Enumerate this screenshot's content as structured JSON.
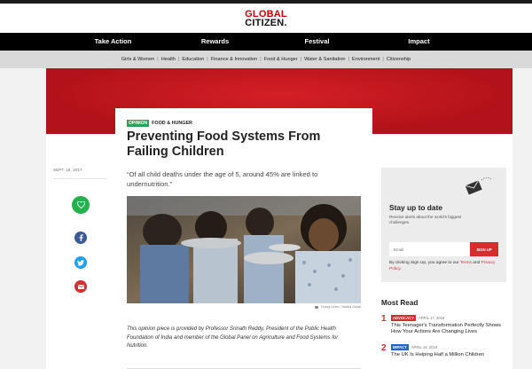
{
  "brand": {
    "line1": "GLOBAL",
    "line2": "CITIZEN."
  },
  "main_nav": [
    "Take Action",
    "Rewards",
    "Festival",
    "Impact"
  ],
  "sub_nav": [
    "Girls & Women",
    "Health",
    "Education",
    "Finance & Innovation",
    "Food & Hunger",
    "Water & Sanitation",
    "Environment",
    "Citizenship"
  ],
  "article": {
    "tag": "OPINION",
    "topic": "FOOD & HUNGER",
    "title": "Preventing Food Systems From Failing Children",
    "date": "SEPT. 16, 2017",
    "quote": "“Of all child deaths under the age of 5, around 45% are linked to undernutrition.”",
    "photo_credit": "Young Lives / Sarika Gulati",
    "caption": "This opinion piece is provided by Professor Srinath Reddy, President of the Public Health Foundation of India and member of the Global Panel on Agriculture and Food Systems for Nutrition."
  },
  "signup": {
    "title": "Stay up to date",
    "description": "Receive alerts about the world's biggest challenges.",
    "email_placeholder": "Email",
    "button": "SIGN UP",
    "terms_prefix": "By clicking Sign Up, you agree to our ",
    "terms_link": "Terms",
    "terms_mid": " and ",
    "privacy_link": "Privacy Policy",
    "terms_suffix": "."
  },
  "most_read": {
    "title": "Most Read",
    "items": [
      {
        "num": "1",
        "tag": "ADVOCACY",
        "tag_color": "#d32f2f",
        "date": "APRIL 17, 2019",
        "text": "This Teenager's Transformation Perfectly Shows How Your Actions Are Changing Lives"
      },
      {
        "num": "2",
        "tag": "IMPACT",
        "tag_color": "#1e66c8",
        "date": "APRIL 16, 2019",
        "text": "The UK Is Helping Half a Million Children"
      }
    ]
  },
  "colors": {
    "brand_red": "#d50000",
    "accent_red": "#d32f2f",
    "opinion_green": "#2e9e55"
  },
  "icons": [
    "heart-icon",
    "facebook-icon",
    "twitter-icon",
    "mail-icon",
    "envelope-icon",
    "camera-icon"
  ]
}
